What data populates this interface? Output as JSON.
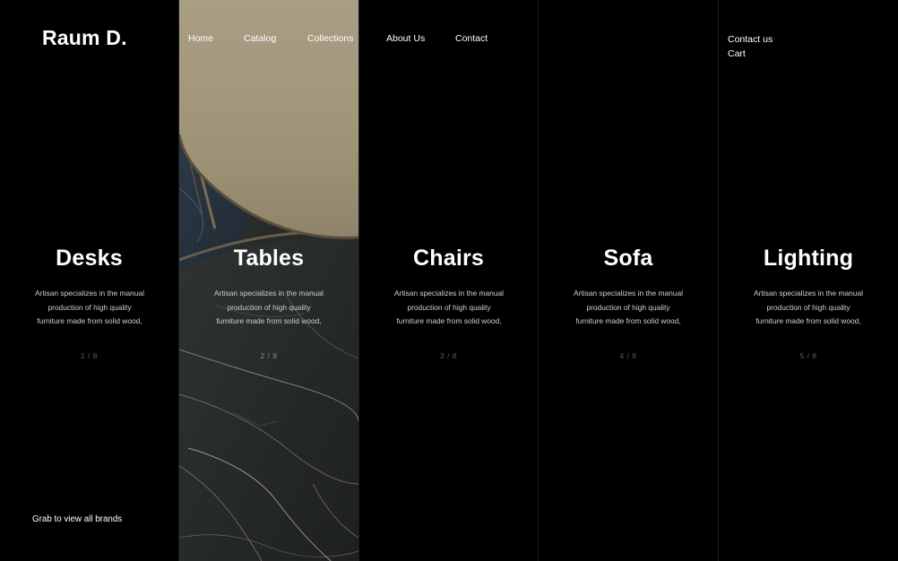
{
  "header": {
    "logo": "Raum D.",
    "nav": [
      "Home",
      "Catalog",
      "Collections",
      "About Us",
      "Contact"
    ],
    "right_links": [
      "Contact us",
      "Cart"
    ]
  },
  "columns": [
    {
      "title": "Desks",
      "description": [
        "Artisan specializes in the manual",
        "production of high quality",
        "furniture made from solid wood,"
      ],
      "counter": "1 / 8"
    },
    {
      "title": "Tables",
      "description": [
        "Artisan specializes in the manual",
        "production of high quality",
        "furniture made from solid wood,"
      ],
      "counter": "2 / 8",
      "background": "marble-table-photo"
    },
    {
      "title": "Chairs",
      "description": [
        "Artisan specializes in the manual",
        "production of high quality",
        "furniture made from solid wood,"
      ],
      "counter": "3 / 8"
    },
    {
      "title": "Sofa",
      "description": [
        "Artisan specializes in the manual",
        "production of high quality",
        "furniture made from solid wood,"
      ],
      "counter": "4 / 8"
    },
    {
      "title": "Lighting",
      "description": [
        "Artisan specializes in the manual",
        "production of high quality",
        "furniture made from solid wood,"
      ],
      "counter": "5 / 8"
    }
  ],
  "footer": {
    "grab_label": "Grab to view all brands"
  },
  "colors": {
    "background": "#000000",
    "text": "#ffffff",
    "muted": "#5c5c5c",
    "table_top": "#a59a7f",
    "marble": "#2b2d2c",
    "marble_vein": "#c8b89a"
  }
}
